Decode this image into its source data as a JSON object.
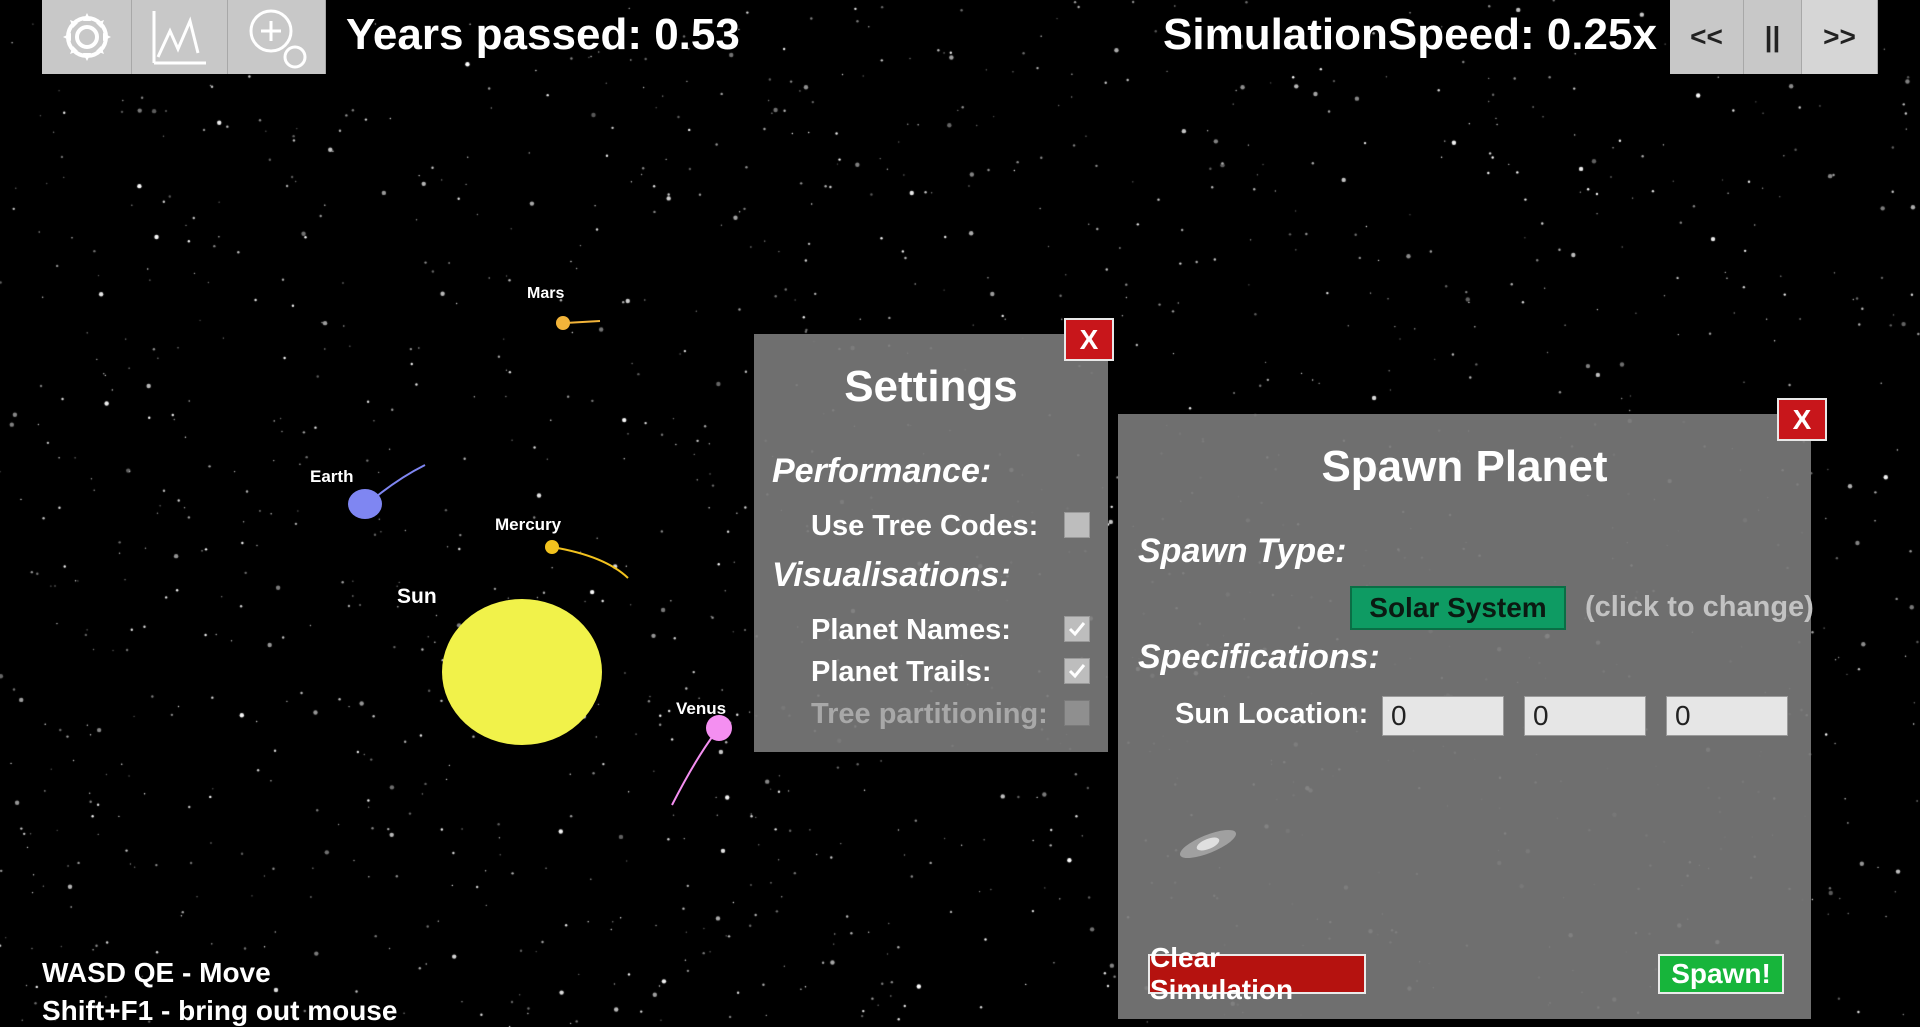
{
  "hud": {
    "years_passed": "Years passed: 0.53",
    "simulation_speed": "SimulationSpeed: 0.25x",
    "speed_buttons": {
      "slower": "<<",
      "pause": "||",
      "faster": ">>"
    }
  },
  "toolbar": {
    "icons": [
      "gear-icon",
      "graph-icon",
      "zoom-in-icon"
    ]
  },
  "scene": {
    "planets": [
      {
        "name": "Mars",
        "color": "#f2b43a"
      },
      {
        "name": "Earth",
        "color": "#7f86f2"
      },
      {
        "name": "Mercury",
        "color": "#f2c21e"
      },
      {
        "name": "Sun",
        "color": "#f1f24a"
      },
      {
        "name": "Venus",
        "color": "#f48ff1"
      }
    ]
  },
  "settings": {
    "title": "Settings",
    "close": "X",
    "performance": "Performance:",
    "use_tree_codes": "Use Tree Codes:",
    "visualisations": "Visualisations:",
    "planet_names": "Planet Names:",
    "planet_trails": "Planet Trails:",
    "tree_partitioning": "Tree partitioning:",
    "checks": {
      "use_tree_codes": false,
      "planet_names": true,
      "planet_trails": true,
      "tree_partitioning": false
    }
  },
  "spawn": {
    "title": "Spawn Planet",
    "close": "X",
    "spawn_type": "Spawn Type:",
    "type_value": "Solar System",
    "type_hint": "(click to change)",
    "specifications": "Specifications:",
    "sun_location": "Sun Location:",
    "x": "0",
    "y": "0",
    "z": "0",
    "clear": "Clear Simulation",
    "spawn": "Spawn!"
  },
  "help": {
    "move": "WASD QE - Move",
    "mouse": "Shift+F1 - bring out mouse"
  }
}
